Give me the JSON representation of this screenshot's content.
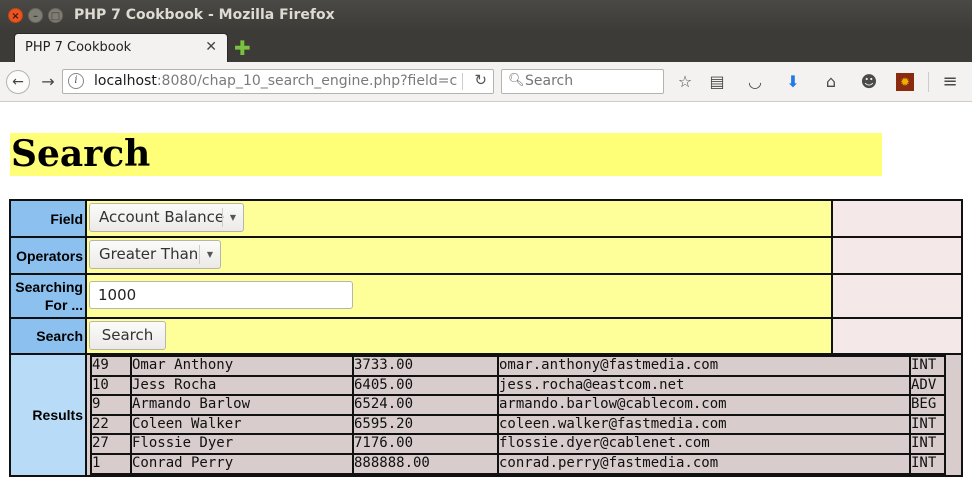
{
  "window": {
    "title": "PHP 7 Cookbook - Mozilla Firefox"
  },
  "tab": {
    "label": "PHP 7 Cookbook",
    "close": "✕",
    "new_tab": "✚"
  },
  "navbar": {
    "url_host": "localhost",
    "url_rest": ":8080/chap_10_search_engine.php?field=c",
    "search_placeholder": "Search",
    "icons": [
      "back-icon",
      "forward-icon",
      "info-icon",
      "reload-icon",
      "search-icon",
      "bookmark-star-icon",
      "reading-list-icon",
      "pocket-icon",
      "download-icon",
      "home-icon",
      "smiley-icon",
      "addon-icon",
      "menu-icon"
    ]
  },
  "page": {
    "heading": "Search",
    "labels": {
      "field": "Field",
      "operators": "Operators",
      "searching_for_line1": "Searching",
      "searching_for_line2": "For ...",
      "search": "Search",
      "results": "Results"
    },
    "field_select": {
      "selected": "Account Balance"
    },
    "operator_select": {
      "selected": "Greater Than"
    },
    "search_input": {
      "value": "1000"
    },
    "search_button": "Search",
    "colors": {
      "heading_bg": "#ffff77",
      "label_bg": "#8cc0ee",
      "control_bg": "#ffff99",
      "side_bg": "#f4e8e8",
      "results_bg": "#d8cccc"
    },
    "results": [
      {
        "id": "49",
        "name": "Omar Anthony",
        "balance": "3733.00",
        "email": "omar.anthony@fastmedia.com",
        "type": "INT"
      },
      {
        "id": "10",
        "name": "Jess Rocha",
        "balance": "6405.00",
        "email": "jess.rocha@eastcom.net",
        "type": "ADV"
      },
      {
        "id": "9",
        "name": "Armando Barlow",
        "balance": "6524.00",
        "email": "armando.barlow@cablecom.com",
        "type": "BEG"
      },
      {
        "id": "22",
        "name": "Coleen Walker",
        "balance": "6595.20",
        "email": "coleen.walker@fastmedia.com",
        "type": "INT"
      },
      {
        "id": "27",
        "name": "Flossie Dyer",
        "balance": "7176.00",
        "email": "flossie.dyer@cablenet.com",
        "type": "INT"
      },
      {
        "id": "1",
        "name": "Conrad Perry",
        "balance": "888888.00",
        "email": "conrad.perry@fastmedia.com",
        "type": "INT"
      }
    ]
  }
}
